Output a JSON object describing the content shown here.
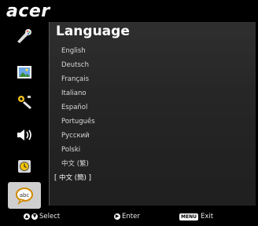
{
  "brand": "acer",
  "menu": {
    "title": "Language",
    "items": [
      "English",
      "Deutsch",
      "Français",
      "Italiano",
      "Español",
      "Português",
      "Pусский",
      "Polski",
      "中文 (繁)",
      "中文 (簡)"
    ],
    "selected_index": 9
  },
  "sidebar": {
    "icons": [
      "color-settings-icon",
      "image-settings-icon",
      "management-settings-icon",
      "audio-settings-icon",
      "timer-settings-icon",
      "language-settings-icon"
    ],
    "active_index": 5
  },
  "footer": {
    "select_label": "Select",
    "enter_label": "Enter",
    "menu_key_label": "MENU",
    "exit_label": "Exit"
  }
}
